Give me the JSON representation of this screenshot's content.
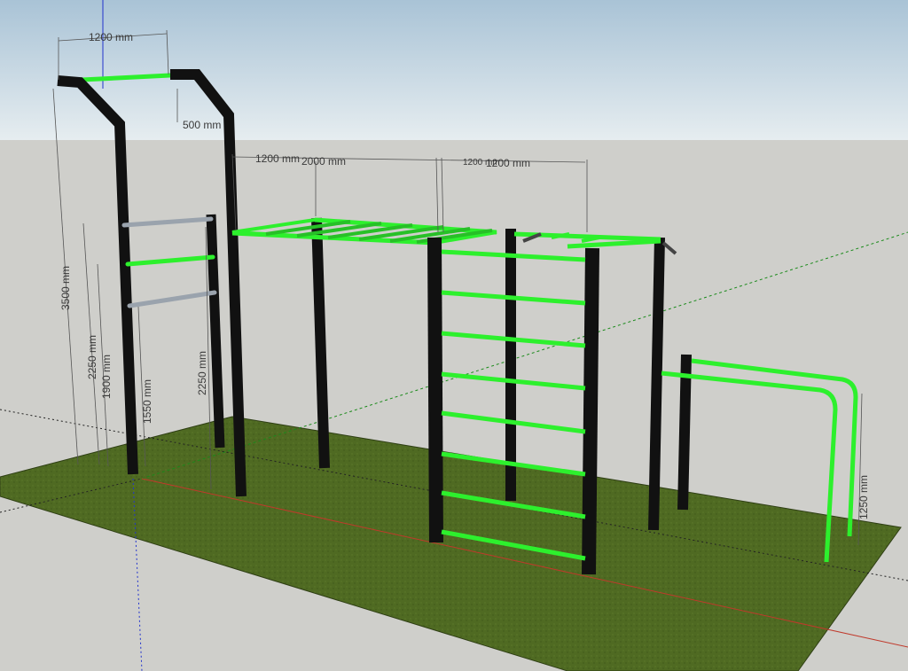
{
  "scene": {
    "colors": {
      "sky_top": "#a9c3d6",
      "sky_bottom": "#e3ebef",
      "ground": "#cfcfcb",
      "grass": "#4f6a22",
      "post": "#111111",
      "bar_green": "#2df02d",
      "bar_grey": "#9aa3ad",
      "dim_line": "#555555",
      "axis_red": "#c0392b",
      "axis_green": "#1a8a1a",
      "axis_blue": "#2233cc"
    }
  },
  "dimensions": {
    "pullup_width": "1200 mm",
    "pullup_depth": "500 mm",
    "total_height": "3500 mm",
    "bar_h_1": "2250 mm",
    "bar_h_2": "1900 mm",
    "bar_h_3": "1550 mm",
    "post_height": "2250 mm",
    "gap_a": "1200 mm",
    "monkey_bars_len": "2000 mm",
    "gap_b": "1200 mm",
    "ladder_len": "1200 mm",
    "dip_height": "1250 mm"
  }
}
